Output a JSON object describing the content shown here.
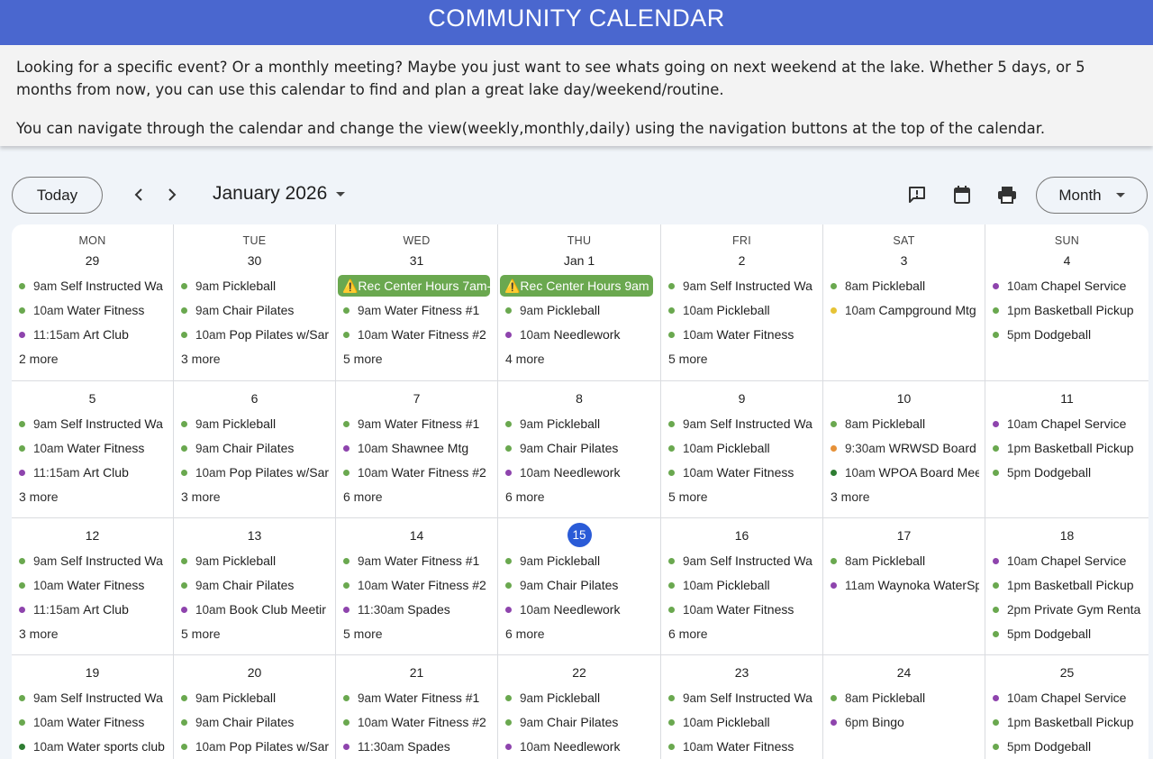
{
  "banner": {
    "title": "COMMUNITY CALENDAR"
  },
  "intro": {
    "p1": "Looking for a specific event? Or a monthly meeting? Maybe you just want to see whats going on next weekend at the lake. Whether 5 days, or 5 months from now, you can use this calendar to find and plan a great lake day/weekend/routine.",
    "p2": "You can navigate through the calendar and change the view(weekly,monthly,daily) using the navigation buttons at the top of the calendar."
  },
  "toolbar": {
    "today_label": "Today",
    "prev_icon": "chevron-left-icon",
    "next_icon": "chevron-right-icon",
    "month_label": "January 2026",
    "view_label": "Month"
  },
  "colors": {
    "green": "#6aa84f",
    "purple": "#8e44ad",
    "yellow": "#e6c335",
    "orange": "#e69138",
    "darkgreen": "#2e7d32",
    "accent": "#2a5bd7",
    "banner": "#4a67cf"
  },
  "weekdays": [
    "MON",
    "TUE",
    "WED",
    "THU",
    "FRI",
    "SAT",
    "SUN"
  ],
  "weeks": [
    [
      {
        "day": "29",
        "events": [
          {
            "t": "9am",
            "n": "Self Instructed Wa",
            "c": "green"
          },
          {
            "t": "10am",
            "n": "Water Fitness",
            "c": "green"
          },
          {
            "t": "11:15am",
            "n": "Art Club",
            "c": "purple"
          }
        ],
        "more": "2 more"
      },
      {
        "day": "30",
        "events": [
          {
            "t": "9am",
            "n": "Pickleball",
            "c": "green"
          },
          {
            "t": "9am",
            "n": "Chair Pilates",
            "c": "green"
          },
          {
            "t": "10am",
            "n": "Pop Pilates w/Sar",
            "c": "green"
          }
        ],
        "more": "3 more"
      },
      {
        "day": "31",
        "allday": "⚠️Rec Center Hours 7am-",
        "events": [
          {
            "t": "9am",
            "n": "Water Fitness #1",
            "c": "green"
          },
          {
            "t": "10am",
            "n": "Water Fitness #2",
            "c": "green"
          }
        ],
        "more": "5 more"
      },
      {
        "day": "Jan 1",
        "allday": "⚠️Rec Center Hours 9am",
        "events": [
          {
            "t": "9am",
            "n": "Pickleball",
            "c": "green"
          },
          {
            "t": "10am",
            "n": "Needlework",
            "c": "purple"
          }
        ],
        "more": "4 more"
      },
      {
        "day": "2",
        "events": [
          {
            "t": "9am",
            "n": "Self Instructed Wa",
            "c": "green"
          },
          {
            "t": "10am",
            "n": "Pickleball",
            "c": "green"
          },
          {
            "t": "10am",
            "n": "Water Fitness",
            "c": "green"
          }
        ],
        "more": "5 more"
      },
      {
        "day": "3",
        "events": [
          {
            "t": "8am",
            "n": "Pickleball",
            "c": "green"
          },
          {
            "t": "10am",
            "n": "Campground Mtg",
            "c": "yellow"
          }
        ],
        "more": ""
      },
      {
        "day": "4",
        "events": [
          {
            "t": "10am",
            "n": "Chapel Service",
            "c": "purple"
          },
          {
            "t": "1pm",
            "n": "Basketball Pickup",
            "c": "green"
          },
          {
            "t": "5pm",
            "n": "Dodgeball",
            "c": "green"
          }
        ],
        "more": ""
      }
    ],
    [
      {
        "day": "5",
        "events": [
          {
            "t": "9am",
            "n": "Self Instructed Wa",
            "c": "green"
          },
          {
            "t": "10am",
            "n": "Water Fitness",
            "c": "green"
          },
          {
            "t": "11:15am",
            "n": "Art Club",
            "c": "purple"
          }
        ],
        "more": "3 more"
      },
      {
        "day": "6",
        "events": [
          {
            "t": "9am",
            "n": "Pickleball",
            "c": "green"
          },
          {
            "t": "9am",
            "n": "Chair Pilates",
            "c": "green"
          },
          {
            "t": "10am",
            "n": "Pop Pilates w/Sar",
            "c": "green"
          }
        ],
        "more": "3 more"
      },
      {
        "day": "7",
        "events": [
          {
            "t": "9am",
            "n": "Water Fitness #1",
            "c": "green"
          },
          {
            "t": "10am",
            "n": "Shawnee Mtg",
            "c": "purple"
          },
          {
            "t": "10am",
            "n": "Water Fitness #2",
            "c": "green"
          }
        ],
        "more": "6 more"
      },
      {
        "day": "8",
        "events": [
          {
            "t": "9am",
            "n": "Pickleball",
            "c": "green"
          },
          {
            "t": "9am",
            "n": "Chair Pilates",
            "c": "green"
          },
          {
            "t": "10am",
            "n": "Needlework",
            "c": "purple"
          }
        ],
        "more": "6 more"
      },
      {
        "day": "9",
        "events": [
          {
            "t": "9am",
            "n": "Self Instructed Wa",
            "c": "green"
          },
          {
            "t": "10am",
            "n": "Pickleball",
            "c": "green"
          },
          {
            "t": "10am",
            "n": "Water Fitness",
            "c": "green"
          }
        ],
        "more": "5 more"
      },
      {
        "day": "10",
        "events": [
          {
            "t": "8am",
            "n": "Pickleball",
            "c": "green"
          },
          {
            "t": "9:30am",
            "n": "WRWSD Board",
            "c": "orange"
          },
          {
            "t": "10am",
            "n": "WPOA Board Mee",
            "c": "darkgreen"
          }
        ],
        "more": "3 more"
      },
      {
        "day": "11",
        "events": [
          {
            "t": "10am",
            "n": "Chapel Service",
            "c": "purple"
          },
          {
            "t": "1pm",
            "n": "Basketball Pickup",
            "c": "green"
          },
          {
            "t": "5pm",
            "n": "Dodgeball",
            "c": "green"
          }
        ],
        "more": ""
      }
    ],
    [
      {
        "day": "12",
        "events": [
          {
            "t": "9am",
            "n": "Self Instructed Wa",
            "c": "green"
          },
          {
            "t": "10am",
            "n": "Water Fitness",
            "c": "green"
          },
          {
            "t": "11:15am",
            "n": "Art Club",
            "c": "purple"
          }
        ],
        "more": "3 more"
      },
      {
        "day": "13",
        "events": [
          {
            "t": "9am",
            "n": "Pickleball",
            "c": "green"
          },
          {
            "t": "9am",
            "n": "Chair Pilates",
            "c": "green"
          },
          {
            "t": "10am",
            "n": "Book Club Meetir",
            "c": "purple"
          }
        ],
        "more": "5 more"
      },
      {
        "day": "14",
        "events": [
          {
            "t": "9am",
            "n": "Water Fitness #1",
            "c": "green"
          },
          {
            "t": "10am",
            "n": "Water Fitness #2",
            "c": "green"
          },
          {
            "t": "11:30am",
            "n": "Spades",
            "c": "purple"
          }
        ],
        "more": "5 more"
      },
      {
        "day": "15",
        "today": true,
        "events": [
          {
            "t": "9am",
            "n": "Pickleball",
            "c": "green"
          },
          {
            "t": "9am",
            "n": "Chair Pilates",
            "c": "green"
          },
          {
            "t": "10am",
            "n": "Needlework",
            "c": "purple"
          }
        ],
        "more": "6 more"
      },
      {
        "day": "16",
        "events": [
          {
            "t": "9am",
            "n": "Self Instructed Wa",
            "c": "green"
          },
          {
            "t": "10am",
            "n": "Pickleball",
            "c": "green"
          },
          {
            "t": "10am",
            "n": "Water Fitness",
            "c": "green"
          }
        ],
        "more": "6 more"
      },
      {
        "day": "17",
        "events": [
          {
            "t": "8am",
            "n": "Pickleball",
            "c": "green"
          },
          {
            "t": "11am",
            "n": "Waynoka WaterSp",
            "c": "purple"
          }
        ],
        "more": ""
      },
      {
        "day": "18",
        "events": [
          {
            "t": "10am",
            "n": "Chapel Service",
            "c": "purple"
          },
          {
            "t": "1pm",
            "n": "Basketball Pickup",
            "c": "green"
          },
          {
            "t": "2pm",
            "n": "Private Gym Renta",
            "c": "green"
          },
          {
            "t": "5pm",
            "n": "Dodgeball",
            "c": "green"
          }
        ],
        "more": ""
      }
    ],
    [
      {
        "day": "19",
        "events": [
          {
            "t": "9am",
            "n": "Self Instructed Wa",
            "c": "green"
          },
          {
            "t": "10am",
            "n": "Water Fitness",
            "c": "green"
          },
          {
            "t": "10am",
            "n": "Water sports club",
            "c": "darkgreen"
          }
        ],
        "more": ""
      },
      {
        "day": "20",
        "events": [
          {
            "t": "9am",
            "n": "Pickleball",
            "c": "green"
          },
          {
            "t": "9am",
            "n": "Chair Pilates",
            "c": "green"
          },
          {
            "t": "10am",
            "n": "Pop Pilates w/Sar",
            "c": "green"
          }
        ],
        "more": ""
      },
      {
        "day": "21",
        "events": [
          {
            "t": "9am",
            "n": "Water Fitness #1",
            "c": "green"
          },
          {
            "t": "10am",
            "n": "Water Fitness #2",
            "c": "green"
          },
          {
            "t": "11:30am",
            "n": "Spades",
            "c": "purple"
          }
        ],
        "more": ""
      },
      {
        "day": "22",
        "events": [
          {
            "t": "9am",
            "n": "Pickleball",
            "c": "green"
          },
          {
            "t": "9am",
            "n": "Chair Pilates",
            "c": "green"
          },
          {
            "t": "10am",
            "n": "Needlework",
            "c": "purple"
          }
        ],
        "more": ""
      },
      {
        "day": "23",
        "events": [
          {
            "t": "9am",
            "n": "Self Instructed Wa",
            "c": "green"
          },
          {
            "t": "10am",
            "n": "Pickleball",
            "c": "green"
          },
          {
            "t": "10am",
            "n": "Water Fitness",
            "c": "green"
          }
        ],
        "more": ""
      },
      {
        "day": "24",
        "events": [
          {
            "t": "8am",
            "n": "Pickleball",
            "c": "green"
          },
          {
            "t": "6pm",
            "n": "Bingo",
            "c": "purple"
          }
        ],
        "more": ""
      },
      {
        "day": "25",
        "events": [
          {
            "t": "10am",
            "n": "Chapel Service",
            "c": "purple"
          },
          {
            "t": "1pm",
            "n": "Basketball Pickup",
            "c": "green"
          },
          {
            "t": "5pm",
            "n": "Dodgeball",
            "c": "green"
          }
        ],
        "more": ""
      }
    ]
  ]
}
